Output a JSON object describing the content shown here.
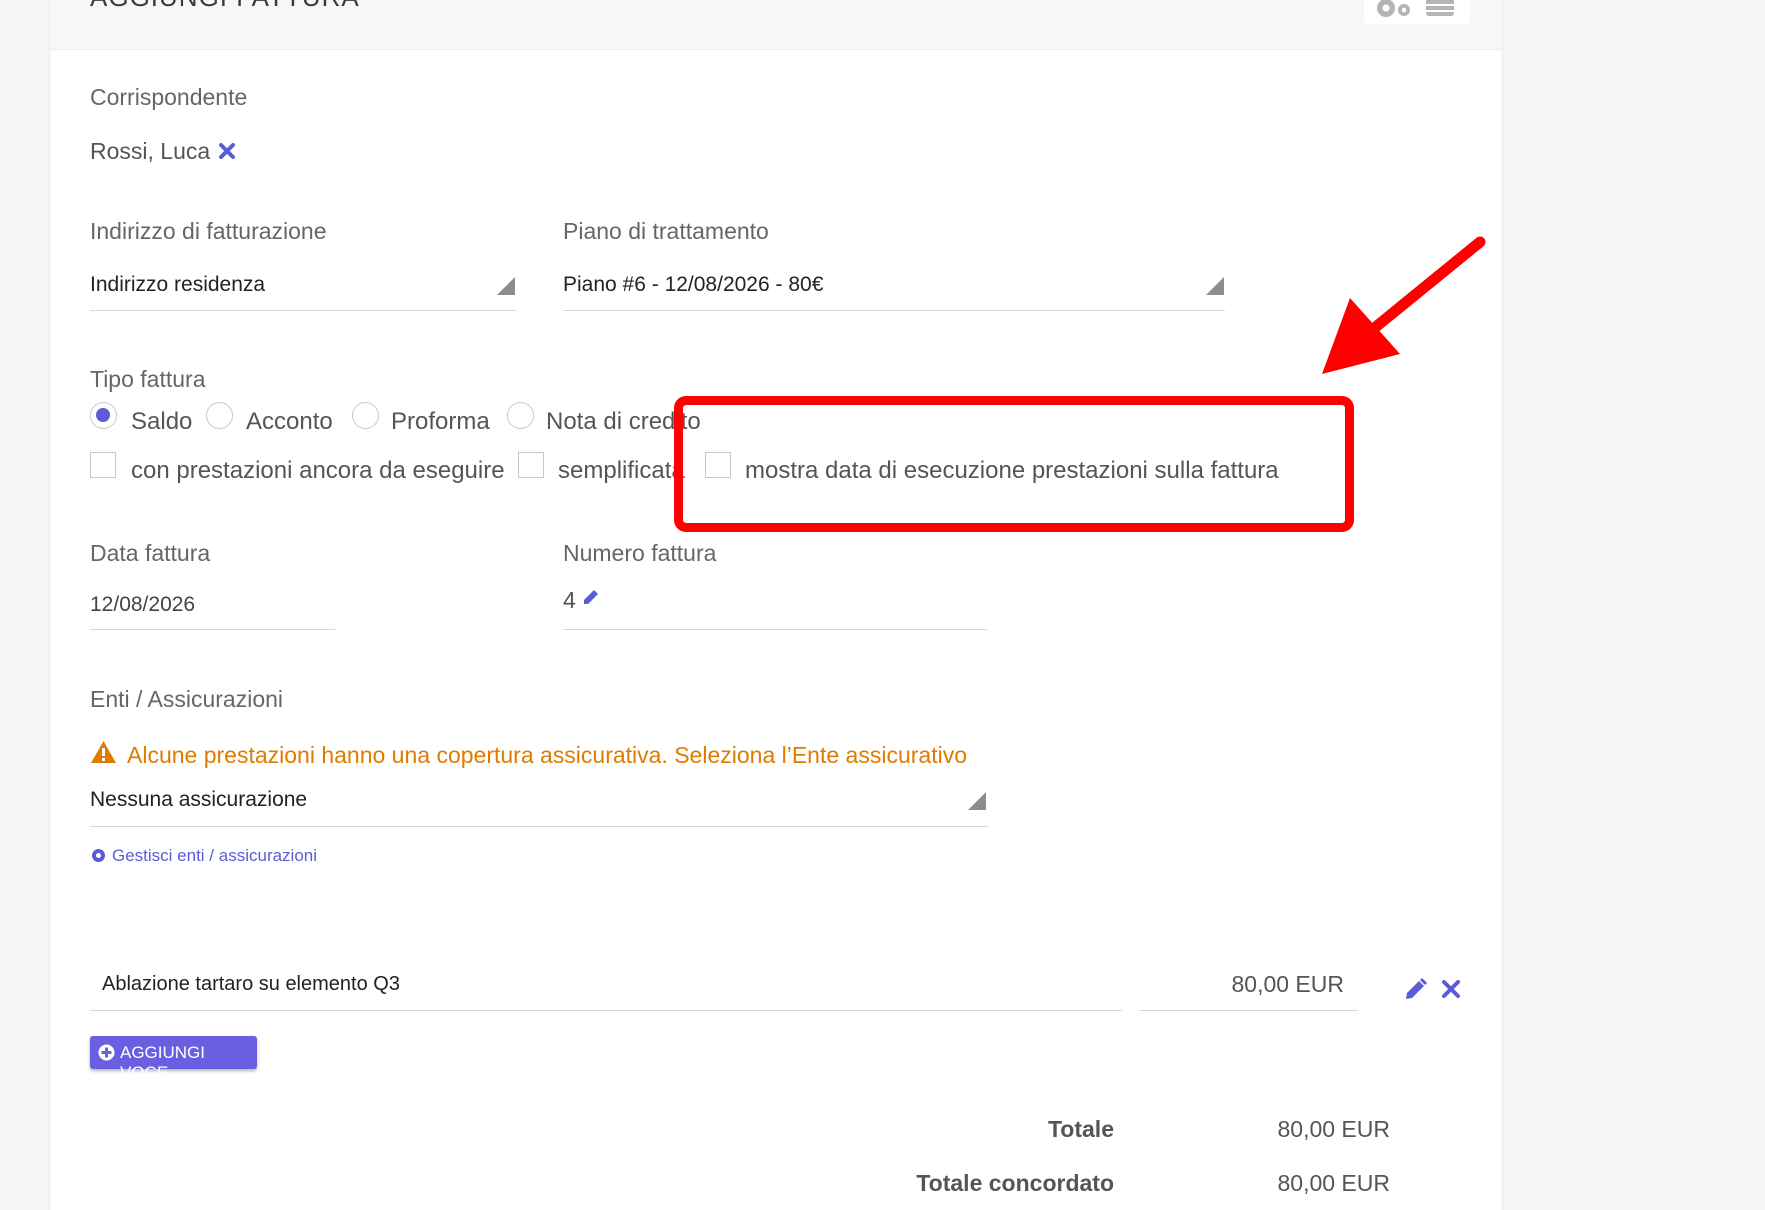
{
  "header": {
    "title": "AGGIUNGI FATTURA"
  },
  "correspondent": {
    "label": "Corrispondente",
    "value": "Rossi, Luca"
  },
  "billing_address": {
    "label": "Indirizzo di fatturazione",
    "value": "Indirizzo residenza"
  },
  "treatment_plan": {
    "label": "Piano di trattamento",
    "value": "Piano #6 - 12/08/2026 - 80€"
  },
  "invoice_type": {
    "label": "Tipo fattura",
    "radios": [
      "Saldo",
      "Acconto",
      "Proforma",
      "Nota di credito"
    ],
    "selected": "Saldo",
    "checkboxes": [
      "con prestazioni ancora da eseguire",
      "semplificata",
      "mostra data di esecuzione prestazioni sulla fattura"
    ]
  },
  "invoice_date": {
    "label": "Data fattura",
    "value": "12/08/2026"
  },
  "invoice_number": {
    "label": "Numero fattura",
    "value": "4"
  },
  "insurance": {
    "label": "Enti / Assicurazioni",
    "warning": "Alcune prestazioni hanno una copertura assicurativa. Seleziona l’Ente assicurativo",
    "value": "Nessuna assicurazione",
    "manage_link": "Gestisci enti / assicurazioni"
  },
  "items": [
    {
      "description": "Ablazione tartaro su elemento Q3",
      "amount": "80,00 EUR"
    }
  ],
  "add_item_button": "AGGIUNGI VOCE",
  "totals": [
    {
      "label": "Totale",
      "value": "80,00 EUR"
    },
    {
      "label": "Totale concordato",
      "value": "80,00 EUR"
    }
  ],
  "colors": {
    "accent": "#5b5bd6",
    "warning": "#e07b00",
    "annotation": "#ff0000"
  },
  "icons": [
    "gears-icon",
    "database-icon",
    "remove-icon",
    "edit-icon",
    "warning-icon",
    "cog-icon",
    "plus-circle-icon",
    "arrow-annotation"
  ]
}
